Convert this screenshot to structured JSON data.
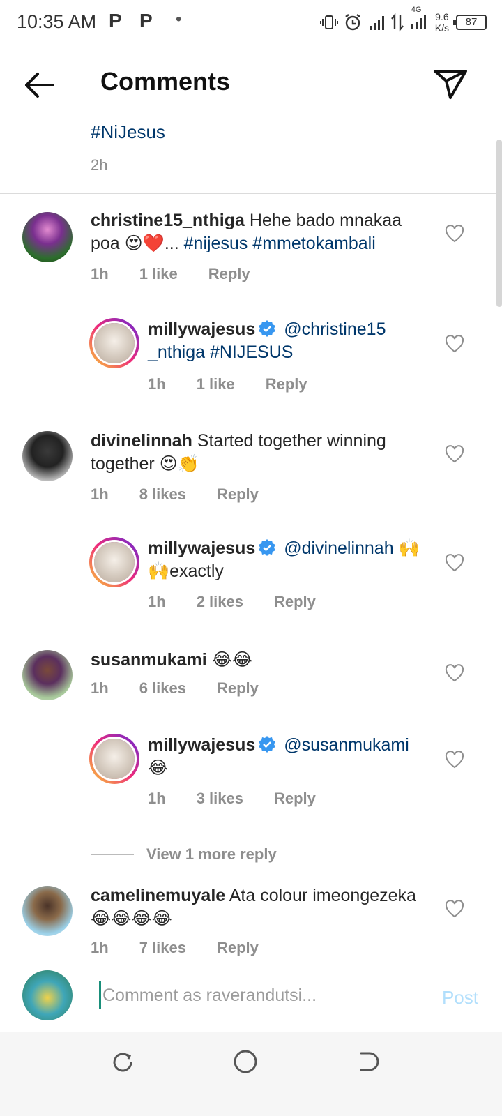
{
  "status_bar": {
    "time": "10:35 AM",
    "notif_p1": "P",
    "notif_p2": "P",
    "dot": "•",
    "network": "4G",
    "speed_value": "9.6",
    "speed_unit": "K/s",
    "battery": "87"
  },
  "header": {
    "title": "Comments"
  },
  "caption": {
    "tail_text": "#NiJesus",
    "time": "2h"
  },
  "comments": [
    {
      "username": "christine15_nthiga",
      "text": " Hehe bado mnakaa poa 😍❤️... ",
      "tags": "#nijesus #mmetokambali",
      "time": "1h",
      "likes": "1 like",
      "reply": "Reply"
    },
    {
      "username": "millywajesus",
      "mention": " @christine15 _nthiga #NIJESUS",
      "text": "",
      "time": "1h",
      "likes": "1 like",
      "reply": "Reply"
    },
    {
      "username": "divinelinnah",
      "text": " Started together winning together 😍👏",
      "time": "1h",
      "likes": "8 likes",
      "reply": "Reply"
    },
    {
      "username": "millywajesus",
      "mention": " @divinelinnah",
      "text": " 🙌🙌exactly",
      "time": "1h",
      "likes": "2 likes",
      "reply": "Reply"
    },
    {
      "username": "susanmukami",
      "text": " 😂😂",
      "time": "1h",
      "likes": "6 likes",
      "reply": "Reply"
    },
    {
      "username": "millywajesus",
      "mention": " @susanmukami",
      "text": " 😂",
      "time": "1h",
      "likes": "3 likes",
      "reply": "Reply"
    },
    {
      "username": "camelinemuyale",
      "text": " Ata  colour imeongezeka😂😂😂😂",
      "time": "1h",
      "likes": "7 likes",
      "reply": "Reply"
    }
  ],
  "view_more_replies": "View 1 more reply",
  "composer": {
    "placeholder": "Comment as raverandutsi...",
    "post_label": "Post"
  },
  "colors": {
    "link": "#00376b",
    "muted": "#8e8e8e",
    "verified": "#3897f0",
    "post_disabled": "#b2dffc"
  }
}
